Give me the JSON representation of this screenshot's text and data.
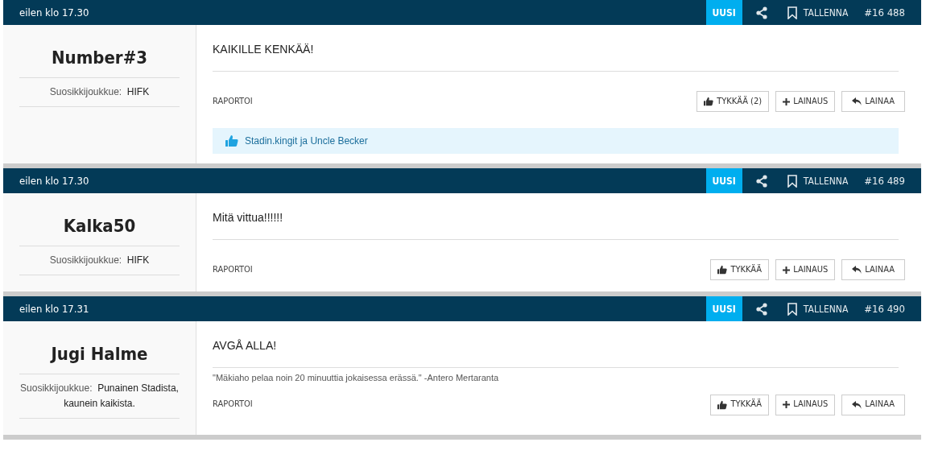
{
  "posts": [
    {
      "time": "eilen klo 17.30",
      "new": true,
      "badge": "UUSI",
      "save": "TALLENNA",
      "number": "#16 488",
      "author": "Number#3",
      "team_label": "Suosikkijoukkue:",
      "team": "HIFK",
      "body": "KAIKILLE KENKÄÄ!",
      "report": "RAPORTOI",
      "like": "TYKKÄÄ (2)",
      "quote": "LAINAUS",
      "reply": "LAINAA",
      "liked_by": "Stadin.kingit ja Uncle Becker"
    },
    {
      "time": "eilen klo 17.30",
      "new": true,
      "badge": "UUSI",
      "save": "TALLENNA",
      "number": "#16 489",
      "author": "Kalka50",
      "team_label": "Suosikkijoukkue:",
      "team": "HIFK",
      "body": "Mitä vittua!!!!!!",
      "report": "RAPORTOI",
      "like": "TYKKÄÄ",
      "quote": "LAINAUS",
      "reply": "LAINAA"
    },
    {
      "time": "eilen klo 17.31",
      "new": true,
      "badge": "UUSI",
      "save": "TALLENNA",
      "number": "#16 490",
      "author": "Jugi Halme",
      "team_label": "Suosikkijoukkue:",
      "team": "Punainen Stadista, kaunein kaikista.",
      "body": "AVGÅ ALLA!",
      "signature": "\"Mäkiaho pelaa noin 20 minuuttia jokaisessa erässä.\" -Antero Mertaranta",
      "report": "RAPORTOI",
      "like": "TYKKÄÄ",
      "quote": "LAINAUS",
      "reply": "LAINAA"
    }
  ]
}
